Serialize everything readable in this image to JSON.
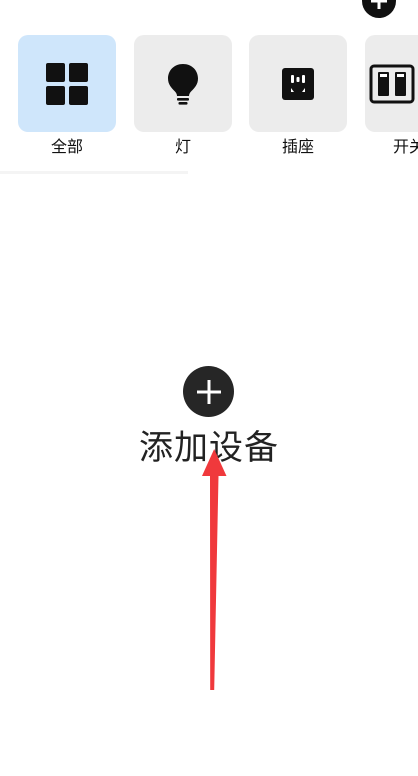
{
  "header": {
    "add_icon": "plus-circle-icon"
  },
  "categories": [
    {
      "label": "全部",
      "icon": "grid-icon",
      "selected": true
    },
    {
      "label": "灯",
      "icon": "lightbulb-icon",
      "selected": false
    },
    {
      "label": "插座",
      "icon": "socket-icon",
      "selected": false
    },
    {
      "label": "开关",
      "icon": "switch-icon",
      "selected": false
    }
  ],
  "empty_state": {
    "label": "添加设备",
    "icon": "plus-circle-icon"
  },
  "colors": {
    "selected_tile": "#cfe6fb",
    "tile": "#ececec",
    "icon": "#111111",
    "annotation_arrow": "#f0393c"
  }
}
